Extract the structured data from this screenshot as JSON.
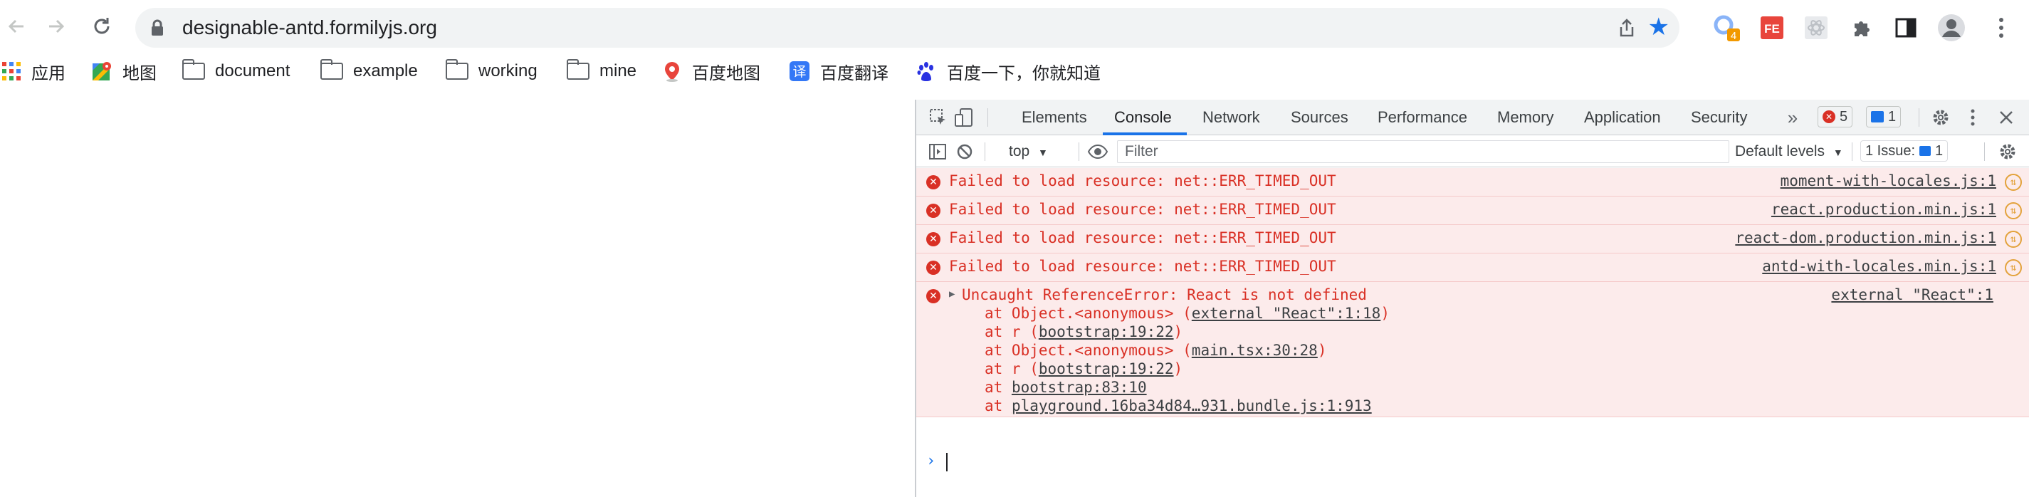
{
  "browser": {
    "url": "designable-antd.formilyjs.org",
    "extensions": [
      {
        "name": "extension-loader-icon",
        "badge": "4"
      },
      {
        "name": "fe-helper-icon",
        "label": "FE"
      },
      {
        "name": "react-devtools-icon"
      },
      {
        "name": "extensions-puzzle-icon"
      },
      {
        "name": "side-panel-icon"
      },
      {
        "name": "profile-avatar-icon"
      },
      {
        "name": "more-menu-icon"
      }
    ]
  },
  "bookmarks": [
    {
      "label": "应用",
      "icon": "apps-grid-icon"
    },
    {
      "label": "地图",
      "icon": "google-maps-icon"
    },
    {
      "label": "document",
      "icon": "folder-icon"
    },
    {
      "label": "example",
      "icon": "folder-icon"
    },
    {
      "label": "working",
      "icon": "folder-icon"
    },
    {
      "label": "mine",
      "icon": "folder-icon"
    },
    {
      "label": "百度地图",
      "icon": "baidu-map-pin-icon"
    },
    {
      "label": "百度翻译",
      "icon": "baidu-translate-icon",
      "glyph": "译"
    },
    {
      "label": "百度一下，你就知道",
      "icon": "baidu-paw-icon"
    }
  ],
  "devtools": {
    "tabs": [
      "Elements",
      "Console",
      "Network",
      "Sources",
      "Performance",
      "Memory",
      "Application",
      "Security"
    ],
    "active_tab": "Console",
    "error_count": "5",
    "message_count": "1",
    "context": "top",
    "filter_placeholder": "Filter",
    "levels_label": "Default levels",
    "issues_label": "1 Issue:",
    "issues_count": "1",
    "messages": [
      {
        "text": "Failed to load resource: net::ERR_TIMED_OUT",
        "source": "moment-with-locales.js:1"
      },
      {
        "text": "Failed to load resource: net::ERR_TIMED_OUT",
        "source": "react.production.min.js:1"
      },
      {
        "text": "Failed to load resource: net::ERR_TIMED_OUT",
        "source": "react-dom.production.min.js:1"
      },
      {
        "text": "Failed to load resource: net::ERR_TIMED_OUT",
        "source": "antd-with-locales.min.js:1"
      }
    ],
    "exception": {
      "text": "Uncaught ReferenceError: React is not defined",
      "source": "external \"React\":1",
      "stack": [
        {
          "prefix": "at Object.<anonymous> (",
          "link": "external \"React\":1:18",
          "suffix": ")"
        },
        {
          "prefix": "at r (",
          "link": "bootstrap:19:22",
          "suffix": ")"
        },
        {
          "prefix": "at Object.<anonymous> (",
          "link": "main.tsx:30:28",
          "suffix": ")"
        },
        {
          "prefix": "at r (",
          "link": "bootstrap:19:22",
          "suffix": ")"
        },
        {
          "prefix": "at ",
          "link": "bootstrap:83:10",
          "suffix": ""
        },
        {
          "prefix": "at ",
          "link": "playground.16ba34d84…931.bundle.js:1:913",
          "suffix": ""
        }
      ]
    },
    "prompt_symbol": "›"
  },
  "colors": {
    "error_red": "#d93025",
    "error_bg": "#fcebeb",
    "accent_blue": "#1a73e8"
  }
}
